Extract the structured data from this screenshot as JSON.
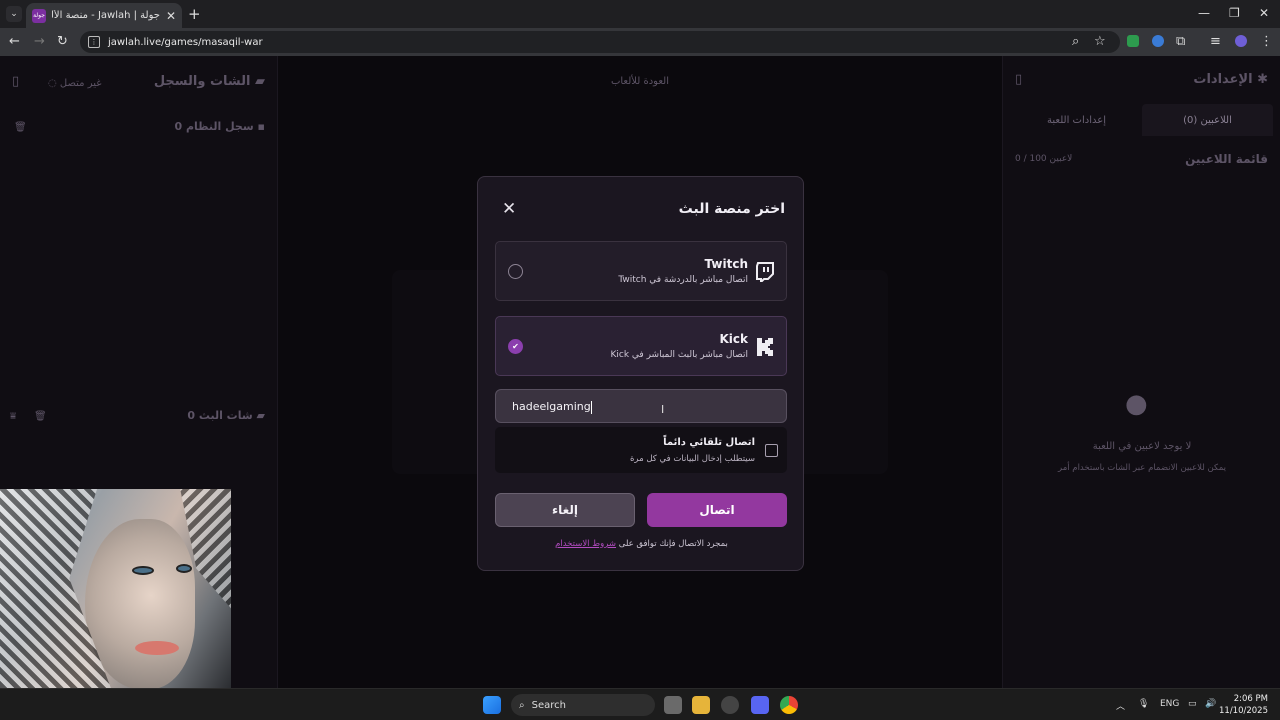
{
  "browser": {
    "tab_title": "جولة | Jawlah - منصة الألعاب الت...",
    "tab_favicon_text": "جولة",
    "url": "jawlah.live/games/masaqil-war"
  },
  "left_panel": {
    "title": "الشات والسجل",
    "status": "غير متصل",
    "system_log": "سجل النظام",
    "system_log_count": "0",
    "stream_chat": "شات البث",
    "stream_chat_count": "0"
  },
  "center": {
    "back_label": "العودة للألعاب"
  },
  "right_panel": {
    "title": "الإعدادات",
    "tab_players": "اللاعبين (0)",
    "tab_game_settings": "إعدادات اللعبة",
    "players_title": "قائمة اللاعبين",
    "players_count": "0 / 100 لاعبين",
    "empty_title": "لا يوجد لاعبين في اللعبة",
    "empty_sub": "يمكن للاعبين الانضمام عبر الشات باستخدام أمر"
  },
  "modal": {
    "title": "اختر منصة البث",
    "options": [
      {
        "name": "Twitch",
        "desc": "اتصال مباشر بالدردشة في Twitch",
        "selected": false
      },
      {
        "name": "Kick",
        "desc": "اتصال مباشر بالبث المباشر في Kick",
        "selected": true
      }
    ],
    "channel_value": "hadeelgaming",
    "auto_connect_label": "اتصال تلقائي دائماً",
    "auto_connect_sub": "سيتطلب إدخال البيانات في كل مرة",
    "cancel_label": "إلغاء",
    "connect_label": "اتصال",
    "terms_prefix": "بمجرد الاتصال فإنك توافق على",
    "terms_link": "شروط الاستخدام"
  },
  "taskbar": {
    "search_label": "Search",
    "lang": "ENG",
    "time": "2:06 PM",
    "date": "11/10/2025"
  },
  "colors": {
    "accent": "#93389f",
    "modal_bg": "#1b1620",
    "page_bg": "#0b090d"
  }
}
